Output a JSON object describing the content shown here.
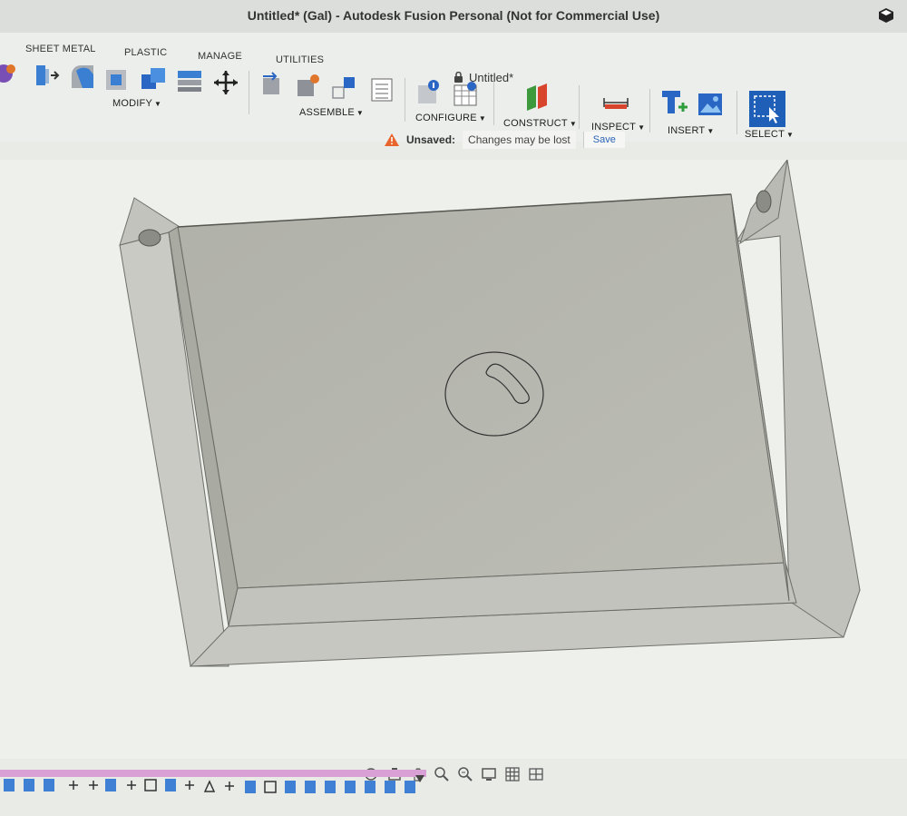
{
  "window": {
    "title": "Untitled* (Gal) - Autodesk Fusion Personal (Not for Commercial Use)",
    "document_tab": "Untitled*"
  },
  "ribbon": {
    "tabs": [
      "SHEET METAL",
      "PLASTIC",
      "MANAGE",
      "UTILITIES"
    ],
    "groups": {
      "modify": "MODIFY",
      "assemble": "ASSEMBLE",
      "configure": "CONFIGURE",
      "construct": "CONSTRUCT",
      "inspect": "INSPECT",
      "insert": "INSERT",
      "select": "SELECT"
    },
    "accent": "#2b6fd6"
  },
  "notification": {
    "label": "Unsaved:",
    "message": "Changes may be lost",
    "save": "Save"
  },
  "viewport": {
    "model_color": "#b7b8b0",
    "background": "#eef0ec"
  },
  "nav_icons": [
    "orbit-icon",
    "look-at-icon",
    "pan-icon",
    "zoom-icon",
    "zoom-window-icon",
    "display-settings-icon",
    "grid-icon",
    "viewports-icon"
  ],
  "timeline": {
    "accent": "#d9a0d6"
  }
}
